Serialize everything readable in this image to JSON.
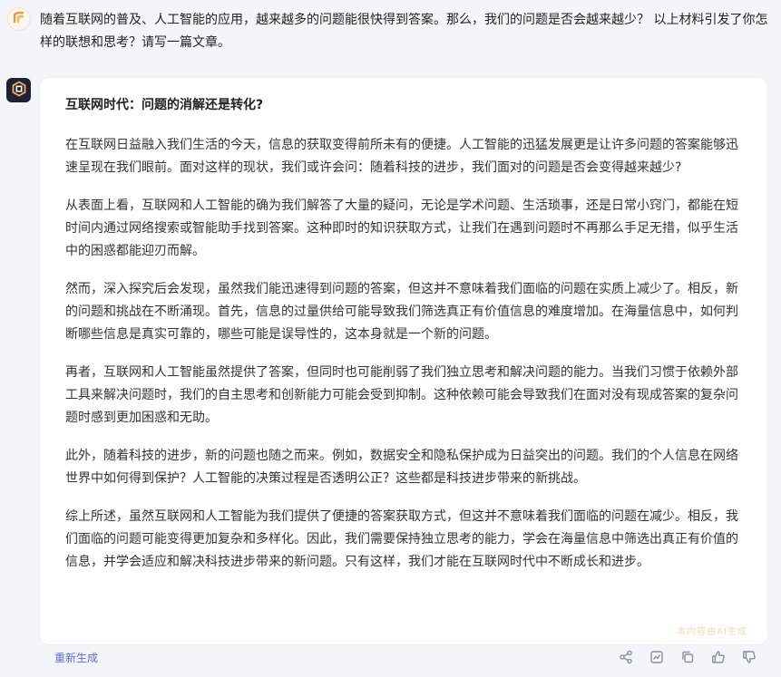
{
  "conversation": {
    "user_message": "随着互联网的普及、人工智能的应用，越来越多的问题能很快得到答案。那么，我们的问题是否会越来越少？ 以上材料引发了你怎样的联想和思考？请写一篇文章。",
    "answer": {
      "title": "互联网时代：问题的消解还是转化?",
      "paragraphs": [
        "在互联网日益融入我们生活的今天，信息的获取变得前所未有的便捷。人工智能的迅猛发展更是让许多问题的答案能够迅速呈现在我们眼前。面对这样的现状，我们或许会问：随着科技的进步，我们面对的问题是否会变得越来越少?",
        "从表面上看，互联网和人工智能的确为我们解答了大量的疑问，无论是学术问题、生活琐事，还是日常小窍门，都能在短时间内通过网络搜索或智能助手找到答案。这种即时的知识获取方式，让我们在遇到问题时不再那么手足无措，似乎生活中的困惑都能迎刃而解。",
        "然而，深入探究后会发现，虽然我们能迅速得到问题的答案，但这并不意味着我们面临的问题在实质上减少了。相反，新的问题和挑战在不断涌现。首先，信息的过量供给可能导致我们筛选真正有价值信息的难度增加。在海量信息中，如何判断哪些信息是真实可靠的，哪些可能是误导性的，这本身就是一个新的问题。",
        "再者，互联网和人工智能虽然提供了答案，但同时也可能削弱了我们独立思考和解决问题的能力。当我们习惯于依赖外部工具来解决问题时，我们的自主思考和创新能力可能会受到抑制。这种依赖可能会导致我们在面对没有现成答案的复杂问题时感到更加困惑和无助。",
        "此外，随着科技的进步，新的问题也随之而来。例如，数据安全和隐私保护成为日益突出的问题。我们的个人信息在网络世界中如何得到保护？人工智能的决策过程是否透明公正？这些都是科技进步带来的新挑战。",
        "综上所述，虽然互联网和人工智能为我们提供了便捷的答案获取方式，但这并不意味着我们面临的问题在减少。相反，我们面临的问题可能变得更加复杂和多样化。因此，我们需要保持独立思考的能力，学会在海量信息中筛选出真正有价值的信息，并学会适应和解决科技进步带来的新问题。只有这样，我们才能在互联网时代中不断成长和进步。"
      ],
      "watermark": "本内容由AI生成"
    }
  },
  "footer": {
    "regenerate_label": "重新生成"
  },
  "icons": {
    "user_avatar": "spark-icon",
    "bot_avatar": "hexagon-logo-icon",
    "share": "share-icon",
    "chart": "chart-icon",
    "copy": "copy-icon",
    "like": "thumbs-up-icon",
    "dislike": "thumbs-down-icon"
  },
  "colors": {
    "page_background": "#f4f5f9",
    "card_background": "#ffffff",
    "accent": "#5b6ee1",
    "icon_gray": "#8a8f9e",
    "user_avatar_orange": "#f29a2e",
    "bot_avatar_dark": "#1f2235"
  }
}
